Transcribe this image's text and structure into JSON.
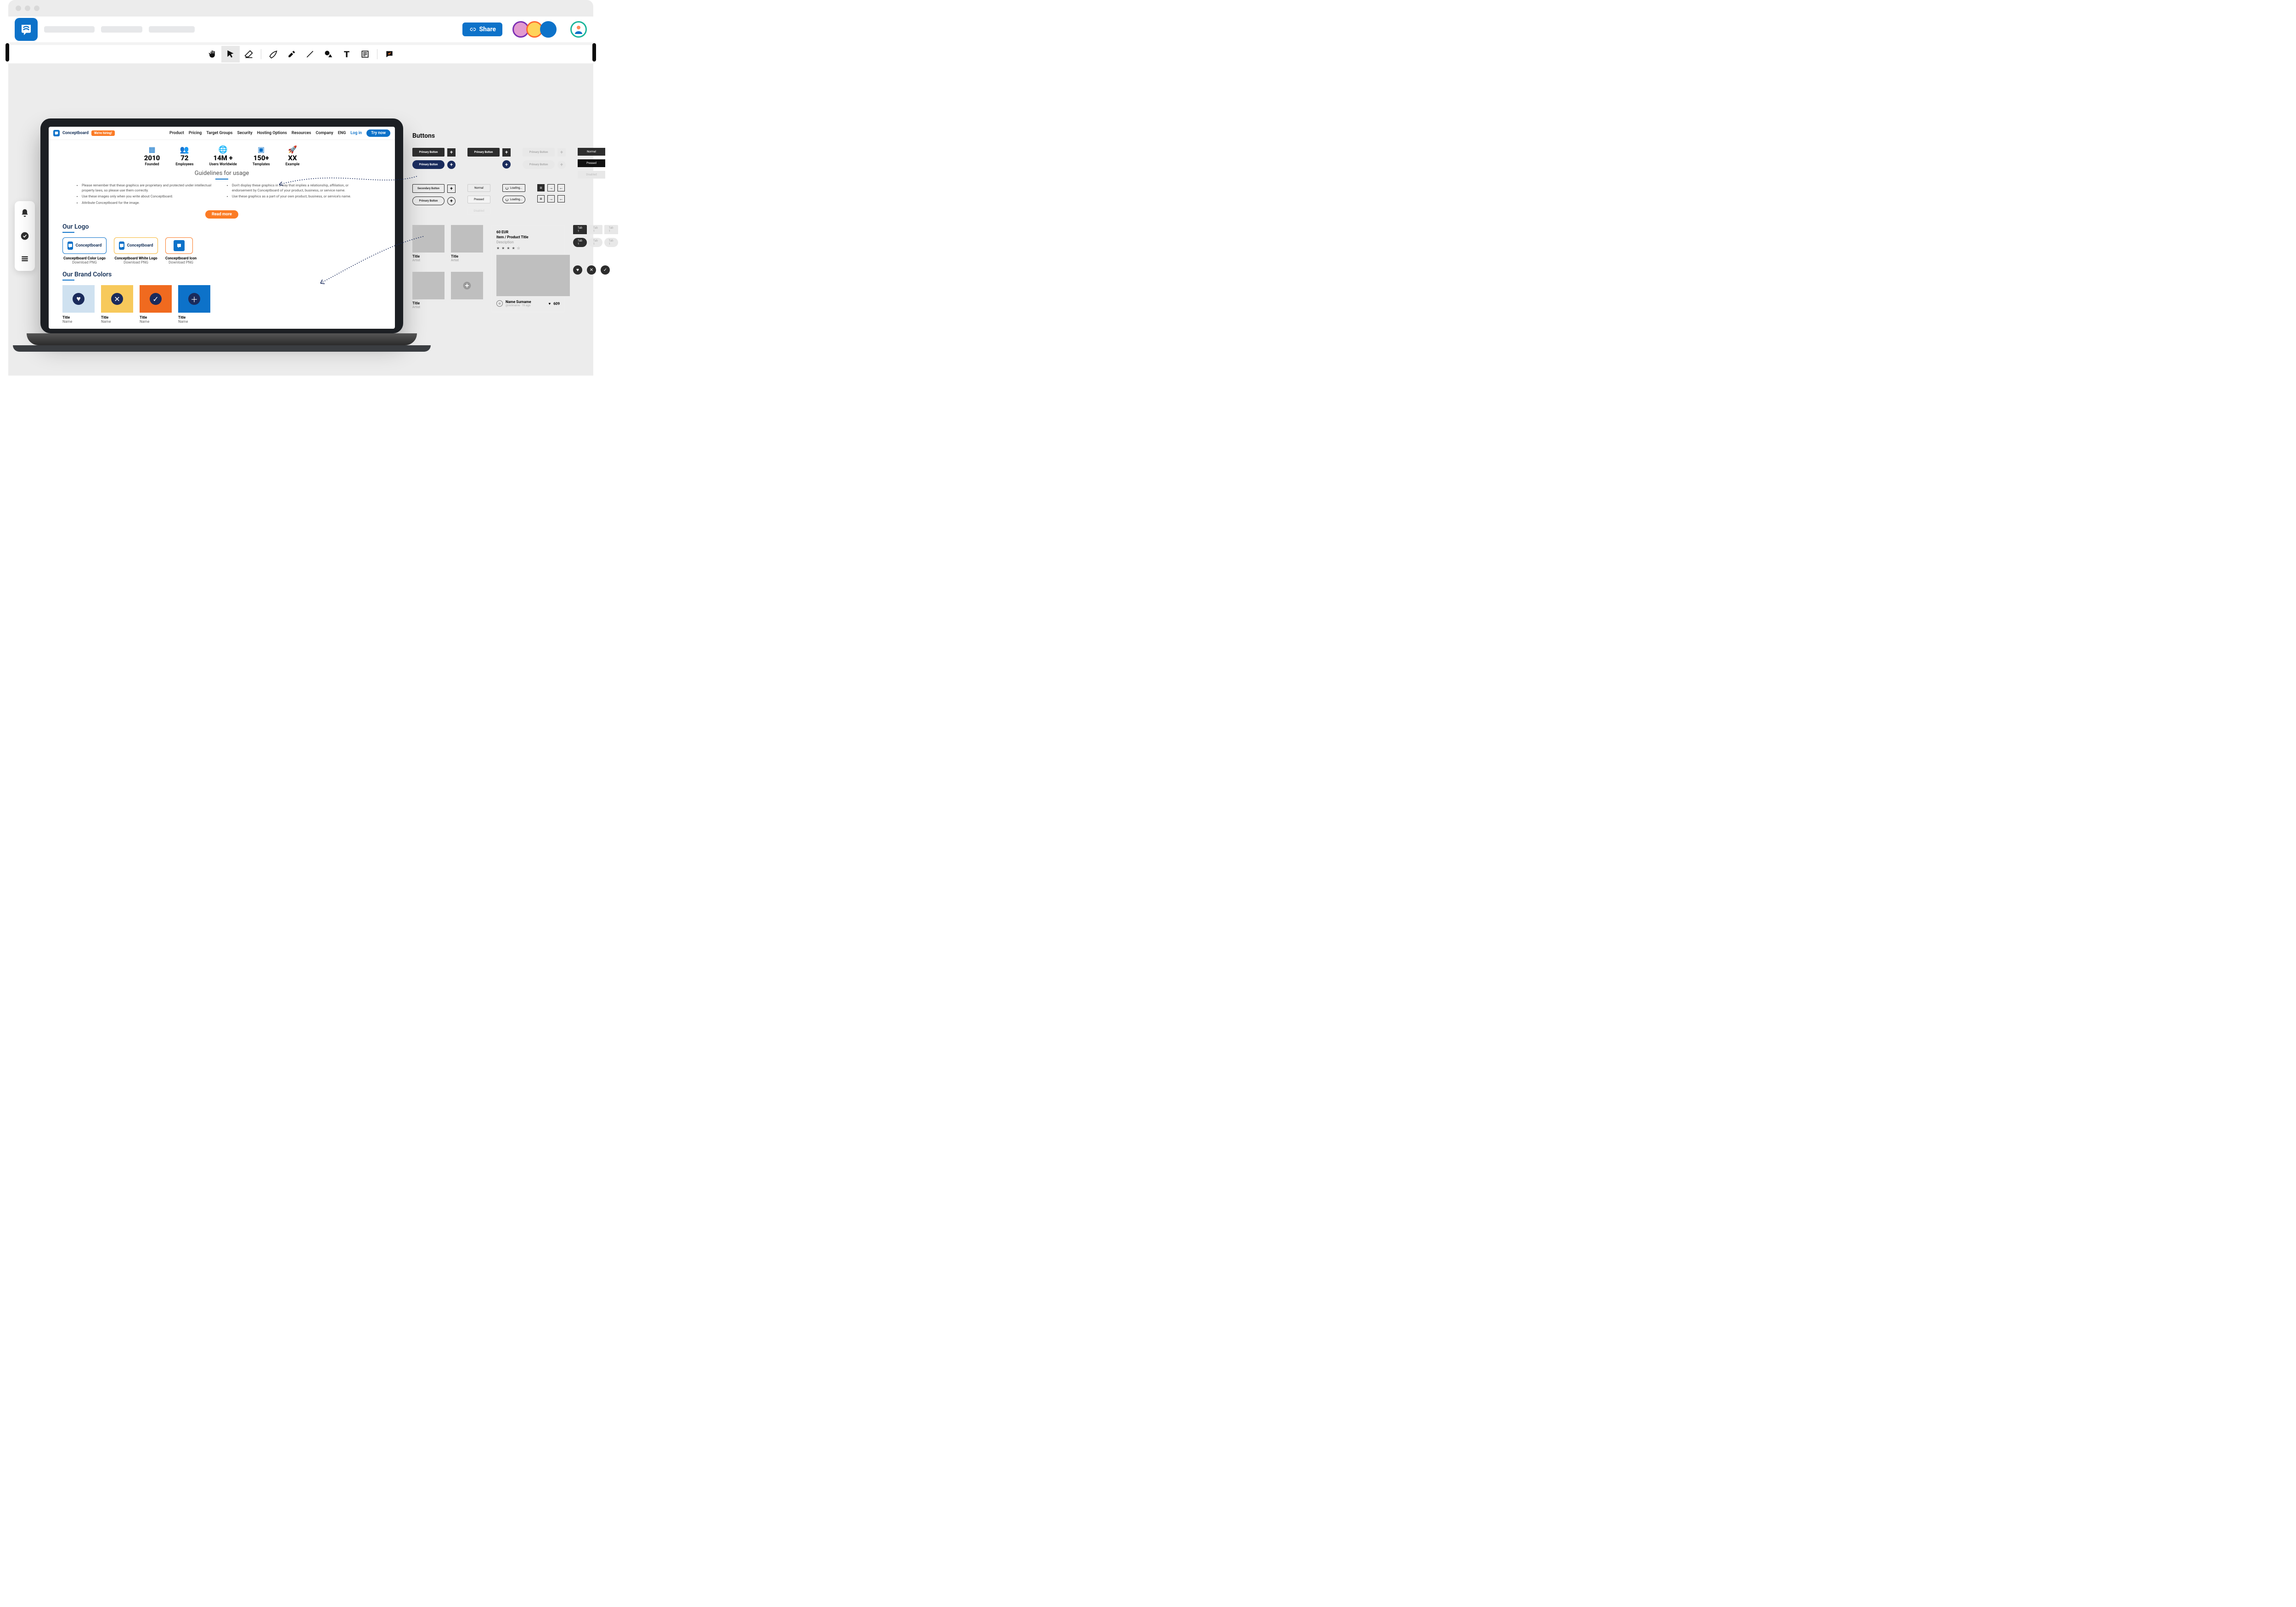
{
  "topbar": {
    "share_label": "Share"
  },
  "toolbar": {
    "tools": [
      "hand",
      "pointer",
      "eraser",
      "pen",
      "highlighter",
      "line",
      "shape",
      "text",
      "note",
      "comment"
    ]
  },
  "left_dock": {
    "items": [
      "notifications",
      "approve",
      "list"
    ]
  },
  "laptop": {
    "brand": "Conceptboard",
    "hiring_badge": "We're hiring!",
    "nav": [
      "Product",
      "Pricing",
      "Target Groups",
      "Security",
      "Hosting Options",
      "Resources",
      "Company",
      "ENG"
    ],
    "login": "Log in",
    "trynow": "Try now",
    "stats": [
      {
        "value": "2010",
        "label": "Founded"
      },
      {
        "value": "72",
        "label": "Employees"
      },
      {
        "value": "14M +",
        "label": "Users Worldwide"
      },
      {
        "value": "150+",
        "label": "Templates"
      },
      {
        "value": "XX",
        "label": "Example"
      }
    ],
    "guidelines_heading": "Guidelines for usage",
    "guidelines_left": [
      "Please remember that these graphics are proprietary and protected under intellectual property laws, so please use them correctly.",
      "Use these images only when you write about Conceptboard.",
      "Attribute Conceptboard for the image."
    ],
    "guidelines_right": [
      "Don't display these graphics in a way that implies a relationship, affiliation, or endorsement by Conceptboard of your product, business, or service name.",
      "Use these graphics as a part of your own product, business, or service's name."
    ],
    "readmore": "Read more",
    "logo_heading": "Our Logo",
    "logos": [
      {
        "title": "Conceptboard Color Logo",
        "sub": "Download PNG",
        "text": "Conceptboard",
        "border": "#0d72c9"
      },
      {
        "title": "Conceptboard White Logo",
        "sub": "Download PNG",
        "text": "Conceptboard",
        "border": "#f7b531"
      },
      {
        "title": "Conceptboard Icon",
        "sub": "Download PNG",
        "text": "",
        "border": "#fb7b25"
      }
    ],
    "colors_heading": "Our Brand Colors",
    "colors": [
      {
        "hex": "#cfe1f0",
        "icon": "heart"
      },
      {
        "hex": "#f7c95b",
        "icon": "close"
      },
      {
        "hex": "#f06a1f",
        "icon": "check"
      },
      {
        "hex": "#0d72c9",
        "icon": "plus"
      }
    ],
    "color_tile_title": "Title",
    "color_tile_name": "Name"
  },
  "uikit": {
    "heading": "Buttons",
    "primary": "Primary Button",
    "secondary": "Secondary Button",
    "normal": "Normal",
    "pressed": "Pressed",
    "disabled": "Disabled",
    "loading": "Loading...",
    "card_title": "Title",
    "card_artist": "Artist",
    "product_price": "60 EUR",
    "product_title": "Item / Product Title",
    "product_desc": "Desciption",
    "user_name": "Name Surname",
    "user_sub": "@nickname · 1h ago",
    "likes": "609",
    "tab_label": "Tab 1"
  }
}
